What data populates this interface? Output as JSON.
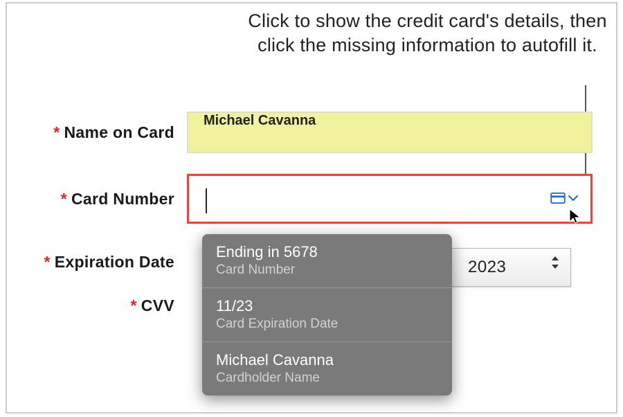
{
  "caption": "Click to show the credit card's details, then click the missing information to autofill it.",
  "fields": {
    "name_on_card": {
      "label": "Name on Card",
      "required_marker": "*",
      "value": "Michael Cavanna"
    },
    "card_number": {
      "label": "Card Number",
      "required_marker": "*",
      "value": ""
    },
    "expiration_date": {
      "label": "Expiration Date",
      "required_marker": "*",
      "year_selected": "2023"
    },
    "cvv": {
      "label": "CVV",
      "required_marker": "*",
      "value": ""
    }
  },
  "autofill_dropdown": [
    {
      "primary": "Ending in 5678",
      "secondary": "Card Number"
    },
    {
      "primary": "11/23",
      "secondary": "Card Expiration Date"
    },
    {
      "primary": "Michael Cavanna",
      "secondary": "Cardholder Name"
    }
  ],
  "icons": {
    "autofill": "credit-card",
    "chevron": "chevron-down",
    "cursor": "arrow-cursor",
    "stepper": "up-down-arrows"
  },
  "colors": {
    "focus_outline": "#ff3d2e",
    "autofilled_bg": "#f0f29e",
    "link_blue": "#1566e0",
    "dropdown_bg": "#7a7a7a",
    "required_red": "#e02626"
  }
}
